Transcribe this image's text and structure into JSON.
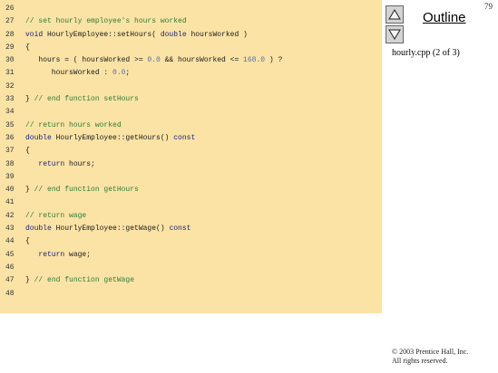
{
  "page_number": "79",
  "nav": {
    "up_label": "▲",
    "down_label": "▼"
  },
  "outline_title": "Outline",
  "file_label": "hourly.cpp (2 of 3)",
  "copyright": {
    "line1": "© 2003 Prentice Hall, Inc.",
    "line2": "All rights reserved."
  },
  "code_lines": [
    {
      "num": "26",
      "tokens": []
    },
    {
      "num": "27",
      "tokens": [
        {
          "t": "// set hourly employee's hours worked",
          "k": "comment"
        }
      ]
    },
    {
      "num": "28",
      "tokens": [
        {
          "t": "void",
          "k": "keyword"
        },
        {
          "t": " HourlyEmployee::setHours( ",
          "k": "plain"
        },
        {
          "t": "double",
          "k": "keyword"
        },
        {
          "t": " hoursWorked )",
          "k": "plain"
        }
      ]
    },
    {
      "num": "29",
      "tokens": [
        {
          "t": "{",
          "k": "plain"
        }
      ]
    },
    {
      "num": "30",
      "tokens": [
        {
          "t": "   hours = ( hoursWorked >= ",
          "k": "plain"
        },
        {
          "t": "0.0",
          "k": "number"
        },
        {
          "t": " && hoursWorked <= ",
          "k": "plain"
        },
        {
          "t": "168.0",
          "k": "number"
        },
        {
          "t": " ) ?",
          "k": "plain"
        }
      ]
    },
    {
      "num": "31",
      "tokens": [
        {
          "t": "      hoursWorked : ",
          "k": "plain"
        },
        {
          "t": "0.0",
          "k": "number"
        },
        {
          "t": ";",
          "k": "plain"
        }
      ]
    },
    {
      "num": "32",
      "tokens": []
    },
    {
      "num": "33",
      "tokens": [
        {
          "t": "} ",
          "k": "plain"
        },
        {
          "t": "// end function setHours",
          "k": "comment"
        }
      ]
    },
    {
      "num": "34",
      "tokens": []
    },
    {
      "num": "35",
      "tokens": [
        {
          "t": "// return hours worked",
          "k": "comment"
        }
      ]
    },
    {
      "num": "36",
      "tokens": [
        {
          "t": "double",
          "k": "keyword"
        },
        {
          "t": " HourlyEmployee::getHours() ",
          "k": "plain"
        },
        {
          "t": "const",
          "k": "keyword"
        }
      ]
    },
    {
      "num": "37",
      "tokens": [
        {
          "t": "{",
          "k": "plain"
        }
      ]
    },
    {
      "num": "38",
      "tokens": [
        {
          "t": "   ",
          "k": "plain"
        },
        {
          "t": "return",
          "k": "keyword"
        },
        {
          "t": " hours;",
          "k": "plain"
        }
      ]
    },
    {
      "num": "39",
      "tokens": []
    },
    {
      "num": "40",
      "tokens": [
        {
          "t": "} ",
          "k": "plain"
        },
        {
          "t": "// end function getHours",
          "k": "comment"
        }
      ]
    },
    {
      "num": "41",
      "tokens": []
    },
    {
      "num": "42",
      "tokens": [
        {
          "t": "// return wage",
          "k": "comment"
        }
      ]
    },
    {
      "num": "43",
      "tokens": [
        {
          "t": "double",
          "k": "keyword"
        },
        {
          "t": " HourlyEmployee::getWage() ",
          "k": "plain"
        },
        {
          "t": "const",
          "k": "keyword"
        }
      ]
    },
    {
      "num": "44",
      "tokens": [
        {
          "t": "{",
          "k": "plain"
        }
      ]
    },
    {
      "num": "45",
      "tokens": [
        {
          "t": "   ",
          "k": "plain"
        },
        {
          "t": "return",
          "k": "keyword"
        },
        {
          "t": " wage;",
          "k": "plain"
        }
      ]
    },
    {
      "num": "46",
      "tokens": []
    },
    {
      "num": "47",
      "tokens": [
        {
          "t": "} ",
          "k": "plain"
        },
        {
          "t": "// end function getWage",
          "k": "comment"
        }
      ]
    },
    {
      "num": "48",
      "tokens": []
    }
  ],
  "colors": {
    "code_background": "#fbe3a6",
    "comment": "#2e7d32",
    "keyword": "#1a237e",
    "number": "#4f6fb0"
  },
  "icons": {
    "up": "triangle-up-icon",
    "down": "triangle-down-icon"
  }
}
